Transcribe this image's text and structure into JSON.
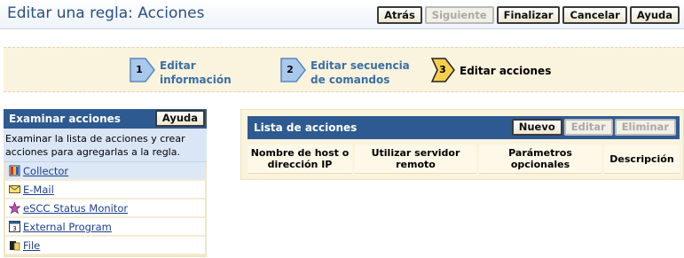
{
  "header": {
    "title": "Editar una regla: Acciones",
    "buttons": {
      "back": "Atrás",
      "next": "Siguiente",
      "finish": "Finalizar",
      "cancel": "Cancelar",
      "help": "Ayuda"
    }
  },
  "steps": [
    {
      "number": "1",
      "label_line1": "Editar",
      "label_line2": "información",
      "state": "done"
    },
    {
      "number": "2",
      "label_line1": "Editar secuencia",
      "label_line2": "de comandos",
      "state": "done"
    },
    {
      "number": "3",
      "label_line1": "Editar acciones",
      "label_line2": "",
      "state": "current"
    }
  ],
  "left_panel": {
    "title": "Examinar acciones",
    "help_button": "Ayuda",
    "description": "Examinar la lista de acciones y crear acciones para agregarlas a la regla.",
    "actions": [
      {
        "label": "Collector",
        "icon": "collector-icon",
        "selected": true
      },
      {
        "label": "E-Mail",
        "icon": "envelope-icon",
        "selected": false
      },
      {
        "label": "eSCC Status Monitor",
        "icon": "status-monitor-icon",
        "selected": false
      },
      {
        "label": "External Program",
        "icon": "program-icon",
        "selected": false
      },
      {
        "label": "File",
        "icon": "file-icon",
        "selected": false
      }
    ]
  },
  "right_panel": {
    "title": "Lista de acciones",
    "buttons": {
      "new": "Nuevo",
      "edit": "Editar",
      "delete": "Eliminar"
    },
    "columns": [
      {
        "line1": "Nombre de host o",
        "line2": "dirección IP"
      },
      {
        "line1": "Utilizar servidor",
        "line2": "remoto"
      },
      {
        "line1": "Parámetros",
        "line2": "opcionales"
      },
      {
        "line1": "Descripción",
        "line2": ""
      }
    ]
  },
  "colors": {
    "header_title": "#2a4f86",
    "panel_header": "#2e5a92",
    "step_bg": "#faf3dd",
    "step_chevron_done": "#a9c9ec",
    "step_chevron_current": "#f3cf4d",
    "link": "#1d3f8c"
  }
}
